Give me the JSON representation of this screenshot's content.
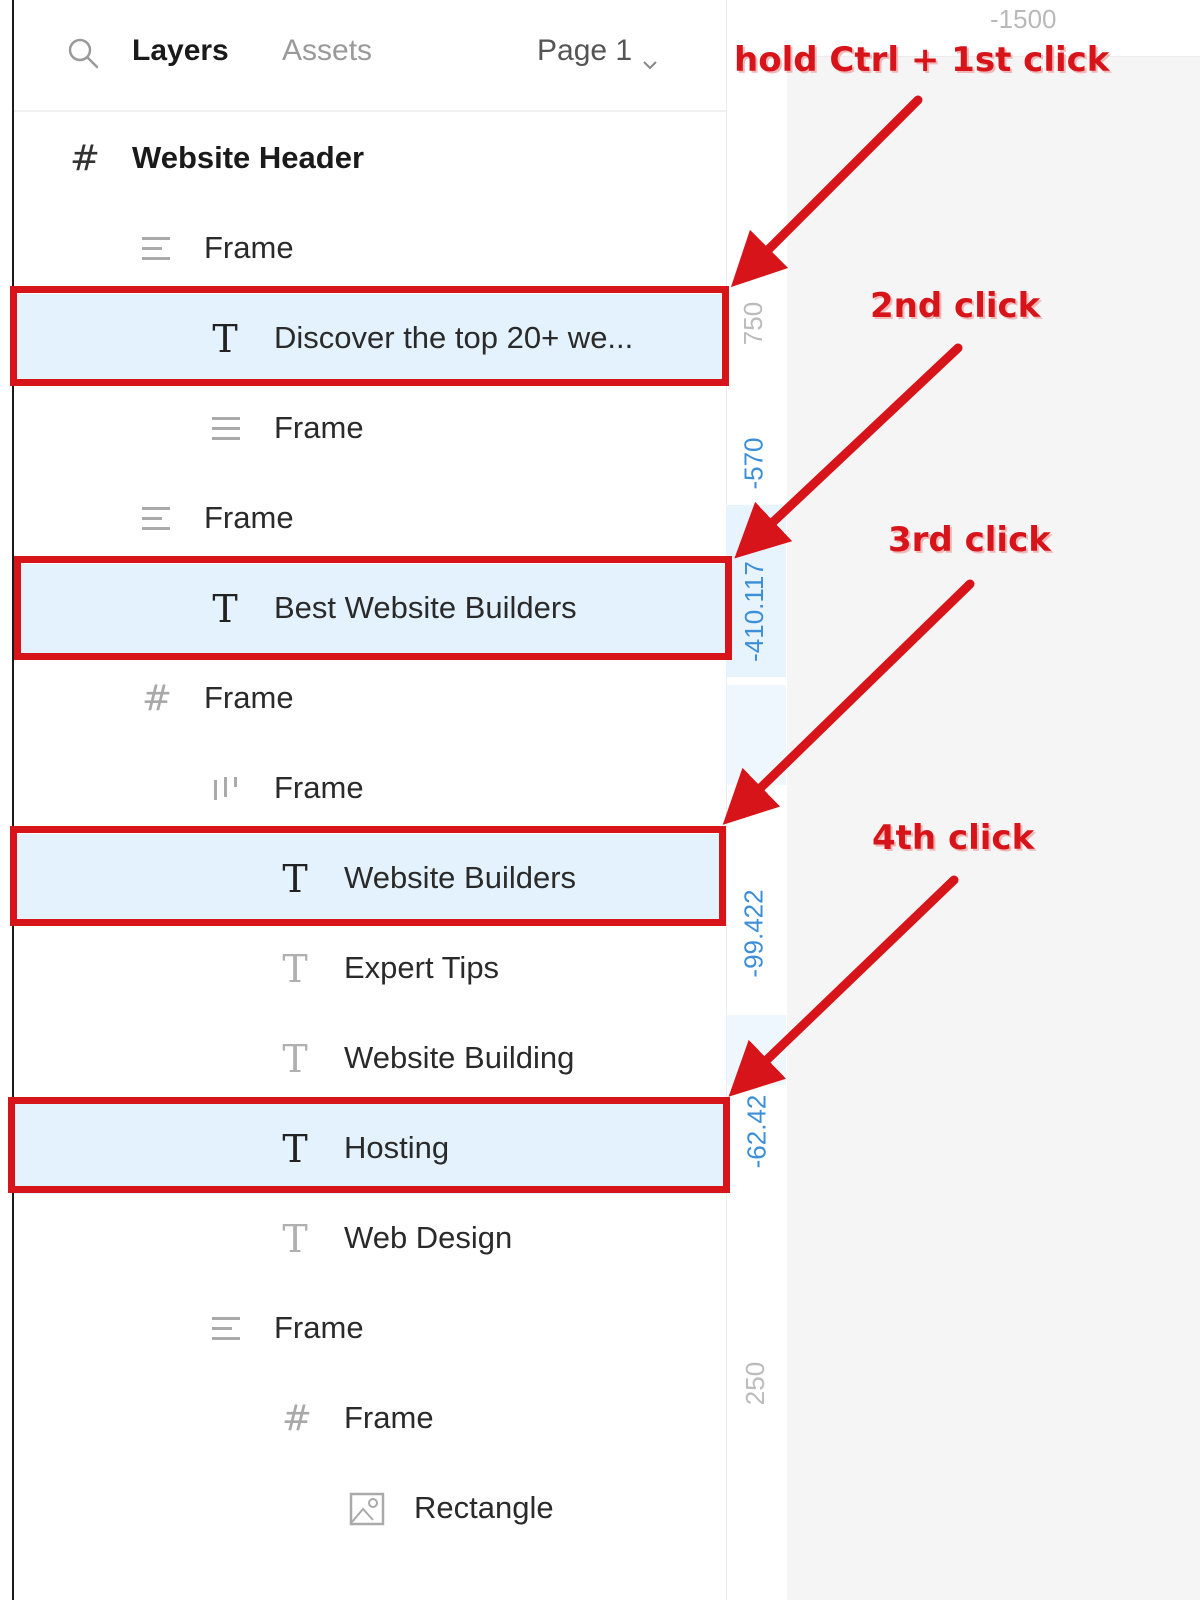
{
  "header": {
    "search_icon": "search-icon",
    "tab_layers": "Layers",
    "tab_assets": "Assets",
    "page_selector": "Page 1"
  },
  "layers": [
    {
      "label": "Website Header",
      "icon": "hash-frame-icon",
      "selected": false
    },
    {
      "label": "Frame",
      "icon": "align-left-icon",
      "selected": false
    },
    {
      "label": "Discover the top 20+ we...",
      "icon": "text-icon",
      "selected": true
    },
    {
      "label": "Frame",
      "icon": "align-left-icon",
      "selected": false
    },
    {
      "label": "Frame",
      "icon": "align-left-icon",
      "selected": false
    },
    {
      "label": "Best Website Builders",
      "icon": "text-icon",
      "selected": true
    },
    {
      "label": "Frame",
      "icon": "hash-frame-icon",
      "selected": false
    },
    {
      "label": "Frame",
      "icon": "columns-icon",
      "selected": false
    },
    {
      "label": "Website Builders",
      "icon": "text-icon",
      "selected": true
    },
    {
      "label": "Expert Tips",
      "icon": "text-icon",
      "selected": false
    },
    {
      "label": "Website Building",
      "icon": "text-icon",
      "selected": false
    },
    {
      "label": "Hosting",
      "icon": "text-icon",
      "selected": true
    },
    {
      "label": "Web Design",
      "icon": "text-icon",
      "selected": false
    },
    {
      "label": "Frame",
      "icon": "align-left-icon",
      "selected": false
    },
    {
      "label": "Frame",
      "icon": "hash-frame-icon",
      "selected": false
    },
    {
      "label": "Rectangle",
      "icon": "image-icon",
      "selected": false
    }
  ],
  "ruler": {
    "top_label": "-1500",
    "labels": [
      "750",
      "-570",
      "-410.117",
      "-99.422",
      "-62.42",
      "250"
    ]
  },
  "annotations": {
    "first": "hold Ctrl + 1st click",
    "second": "2nd click",
    "third": "3rd click",
    "fourth": "4th click"
  },
  "colors": {
    "selection": "#e3f2fd",
    "highlight": "#d7141a",
    "ruler_blue": "#3b8ed8"
  }
}
